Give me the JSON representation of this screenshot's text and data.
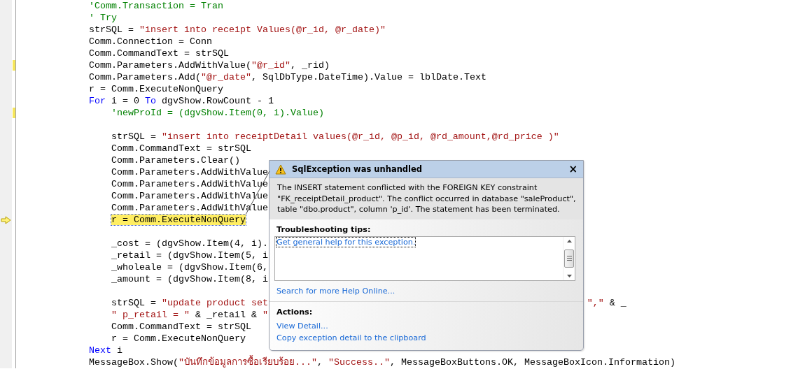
{
  "editor": {
    "lines": [
      {
        "changed": false,
        "current": false,
        "tokens": [
          {
            "kind": "comment",
            "text": "'Comm.Transaction = Tran"
          }
        ]
      },
      {
        "changed": false,
        "current": false,
        "tokens": [
          {
            "kind": "comment",
            "text": "' Try"
          }
        ]
      },
      {
        "changed": false,
        "current": false,
        "tokens": [
          {
            "kind": "plain",
            "text": "strSQL = "
          },
          {
            "kind": "string",
            "text": "\"insert into receipt Values(@r_id, @r_date)\""
          }
        ]
      },
      {
        "changed": false,
        "current": false,
        "tokens": [
          {
            "kind": "plain",
            "text": "Comm.Connection = Conn"
          }
        ]
      },
      {
        "changed": false,
        "current": false,
        "tokens": [
          {
            "kind": "plain",
            "text": "Comm.CommandText = strSQL"
          }
        ]
      },
      {
        "changed": true,
        "current": false,
        "tokens": [
          {
            "kind": "plain",
            "text": "Comm.Parameters.AddWithValue("
          },
          {
            "kind": "string",
            "text": "\"@r_id\""
          },
          {
            "kind": "plain",
            "text": ", _rid)"
          }
        ]
      },
      {
        "changed": false,
        "current": false,
        "tokens": [
          {
            "kind": "plain",
            "text": "Comm.Parameters.Add("
          },
          {
            "kind": "string",
            "text": "\"@r_date\""
          },
          {
            "kind": "plain",
            "text": ", SqlDbType.DateTime).Value = lblDate.Text"
          }
        ]
      },
      {
        "changed": false,
        "current": false,
        "tokens": [
          {
            "kind": "plain",
            "text": "r = Comm.ExecuteNonQuery"
          }
        ]
      },
      {
        "changed": false,
        "current": false,
        "tokens": [
          {
            "kind": "keyword",
            "text": "For"
          },
          {
            "kind": "plain",
            "text": " i = 0 "
          },
          {
            "kind": "keyword",
            "text": "To"
          },
          {
            "kind": "plain",
            "text": " dgvShow.RowCount - 1"
          }
        ],
        "children": [
          {
            "changed": true,
            "current": false,
            "tokens": [
              {
                "kind": "comment",
                "text": "'newProId = (dgvShow.Item(0, i).Value)"
              }
            ]
          },
          {
            "changed": false,
            "current": false
          },
          {
            "changed": false,
            "current": false,
            "tokens": [
              {
                "kind": "plain",
                "text": "strSQL = "
              },
              {
                "kind": "string",
                "text": "\"insert into receiptDetail values(@r_id, @p_id, @rd_amount,@rd_price )\""
              }
            ]
          },
          {
            "changed": false,
            "current": false,
            "tokens": [
              {
                "kind": "plain",
                "text": "Comm.CommandText = strSQL"
              }
            ]
          },
          {
            "changed": false,
            "current": false,
            "tokens": [
              {
                "kind": "plain",
                "text": "Comm.Parameters.Clear()"
              }
            ]
          },
          {
            "changed": false,
            "current": false,
            "tokens": [
              {
                "kind": "plain",
                "text": "Comm.Parameters.AddWithValue"
              }
            ]
          },
          {
            "changed": false,
            "current": false,
            "tokens": [
              {
                "kind": "plain",
                "text": "Comm.Parameters.AddWithValue"
              }
            ]
          },
          {
            "changed": false,
            "current": false,
            "tokens": [
              {
                "kind": "plain",
                "text": "Comm.Parameters.AddWithValue"
              }
            ]
          },
          {
            "changed": false,
            "current": false,
            "tokens": [
              {
                "kind": "plain",
                "text": "Comm.Parameters.AddWithValue"
              }
            ]
          },
          {
            "changed": false,
            "current": true,
            "tokens": [
              {
                "kind": "plain",
                "text": "r = Comm.ExecuteNonQuery"
              }
            ]
          },
          {
            "changed": false,
            "current": false
          },
          {
            "changed": false,
            "current": false,
            "tokens": [
              {
                "kind": "plain",
                "text": "_cost = (dgvShow.Item(4, i)."
              }
            ]
          },
          {
            "changed": false,
            "current": false,
            "tokens": [
              {
                "kind": "plain",
                "text": "_retail = (dgvShow.Item(5, i"
              }
            ]
          },
          {
            "changed": false,
            "current": false,
            "tokens": [
              {
                "kind": "plain",
                "text": "_wholeale = (dgvShow.Item(6,"
              }
            ]
          },
          {
            "changed": false,
            "current": false,
            "tokens": [
              {
                "kind": "plain",
                "text": "_amount = (dgvShow.Item(8, i"
              }
            ]
          },
          {
            "changed": false,
            "current": false
          },
          {
            "changed": false,
            "current": false,
            "tokens": [
              {
                "kind": "plain",
                "text": "strSQL = "
              },
              {
                "kind": "string",
                "text": "\"update product set"
              }
            ],
            "tail": [
              {
                "kind": "string",
                "text": "\",\""
              },
              {
                "kind": "plain",
                "text": " & _"
              }
            ]
          },
          {
            "changed": false,
            "current": false,
            "tokens": [
              {
                "kind": "string",
                "text": "\" p_retail = \""
              },
              {
                "kind": "plain",
                "text": " & _retail & "
              },
              {
                "kind": "string",
                "text": "\""
              }
            ]
          },
          {
            "changed": false,
            "current": false,
            "tokens": [
              {
                "kind": "plain",
                "text": "Comm.CommandText = strSQL"
              }
            ]
          },
          {
            "changed": false,
            "current": false,
            "tokens": [
              {
                "kind": "plain",
                "text": "r = Comm.ExecuteNonQuery"
              }
            ]
          }
        ]
      },
      {
        "changed": false,
        "current": false,
        "tokens": [
          {
            "kind": "keyword",
            "text": "Next"
          },
          {
            "kind": "plain",
            "text": " i"
          }
        ]
      },
      {
        "changed": false,
        "current": false,
        "tokens": [
          {
            "kind": "plain",
            "text": "MessageBox.Show("
          },
          {
            "kind": "string",
            "text": "\"บันทึกข้อมูลการซื้อเรียบร้อย...\""
          },
          {
            "kind": "plain",
            "text": ", "
          },
          {
            "kind": "string",
            "text": "\"Success..\""
          },
          {
            "kind": "plain",
            "text": ", MessageBoxButtons.OK, MessageBoxIcon.Information)"
          }
        ]
      }
    ]
  },
  "exception_dialog": {
    "title": "SqlException was unhandled",
    "close": "×",
    "message": "The INSERT statement conflicted with the FOREIGN KEY constraint \"FK_receiptDetail_product\". The conflict occurred in database \"saleProduct\", table \"dbo.product\", column 'p_id'. The statement has been terminated.",
    "tips_heading": "Troubleshooting tips:",
    "tips": [
      "Get general help for this exception."
    ],
    "search_link": "Search for more Help Online...",
    "actions_heading": "Actions:",
    "actions": [
      "View Detail...",
      "Copy exception detail to the clipboard"
    ]
  }
}
